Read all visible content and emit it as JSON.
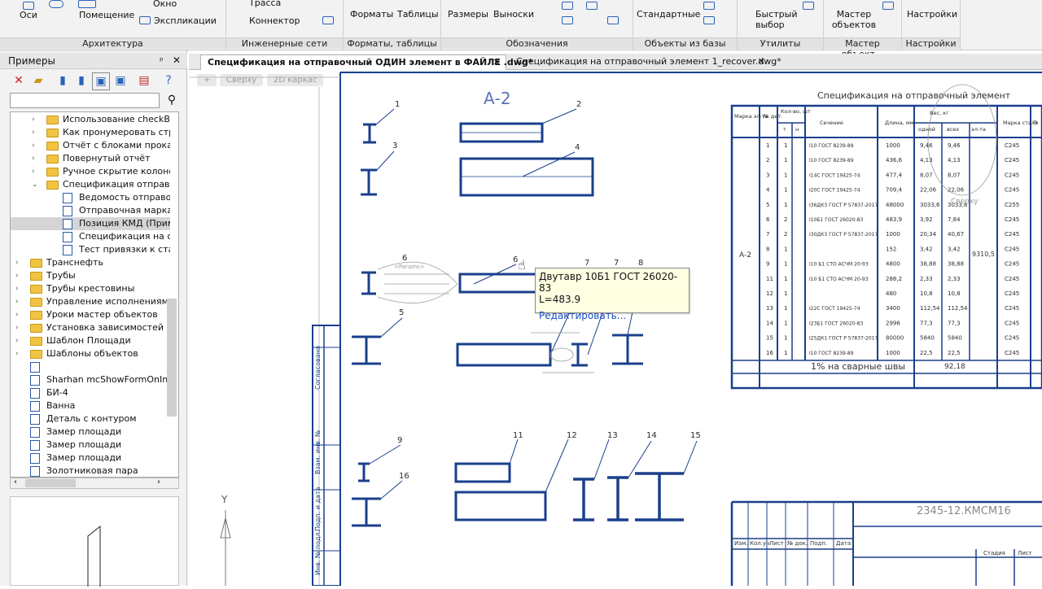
{
  "ribbon": {
    "groups": [
      {
        "label": "Архитектура",
        "items": [
          "Оси",
          "Помещение",
          "Окно",
          "Экспликации"
        ]
      },
      {
        "label": "Инженерные сети",
        "items": [
          "Трасса",
          "Коннектор"
        ]
      },
      {
        "label": "Форматы, таблицы",
        "items": [
          "Форматы",
          "Таблицы"
        ]
      },
      {
        "label": "Обозначения",
        "items": [
          "Размеры",
          "Выноски"
        ]
      },
      {
        "label": "Объекты из базы",
        "items": [
          "Стандартные"
        ]
      },
      {
        "label": "Утилиты",
        "items": [
          "Быстрый выбор"
        ]
      },
      {
        "label": "Мастер объект...",
        "items": [
          "Мастер объектов"
        ]
      },
      {
        "label": "Настройки",
        "items": [
          "Настройки"
        ]
      }
    ]
  },
  "panel": {
    "title": "Примеры",
    "pin": "ᵖ",
    "close": "✕",
    "search_placeholder": "",
    "tree": [
      {
        "label": "Использование checkBox",
        "type": "folder",
        "level": 1,
        "twist": "›"
      },
      {
        "label": "Как пронумеровать строки",
        "type": "folder",
        "level": 1,
        "twist": "›"
      },
      {
        "label": "Отчёт с блоками проката",
        "type": "folder",
        "level": 1,
        "twist": "›"
      },
      {
        "label": "Повернутый отчёт",
        "type": "folder",
        "level": 1,
        "twist": "›"
      },
      {
        "label": "Ручное скрытие колонок",
        "type": "folder",
        "level": 1,
        "twist": "›"
      },
      {
        "label": "Спецификация отправочн",
        "type": "folder",
        "level": 1,
        "twist": "⌄"
      },
      {
        "label": "Ведомость отправочн",
        "type": "doc",
        "level": 2,
        "twist": ""
      },
      {
        "label": "Отправочная марка",
        "type": "doc",
        "level": 2,
        "twist": ""
      },
      {
        "label": "Позиция КМД (Приме",
        "type": "doc",
        "level": 2,
        "twist": "",
        "selected": true
      },
      {
        "label": "Спецификация на отп",
        "type": "doc",
        "level": 2,
        "twist": ""
      },
      {
        "label": "Тест привязки к стан",
        "type": "doc",
        "level": 2,
        "twist": ""
      },
      {
        "label": "Транснефть",
        "type": "folder",
        "level": 0,
        "twist": "›"
      },
      {
        "label": "Трубы",
        "type": "folder",
        "level": 0,
        "twist": "›"
      },
      {
        "label": "Трубы крестовины",
        "type": "folder",
        "level": 0,
        "twist": "›"
      },
      {
        "label": "Управление исполнениями и",
        "type": "folder",
        "level": 0,
        "twist": "›"
      },
      {
        "label": "Уроки мастер объектов",
        "type": "folder",
        "level": 0,
        "twist": "›"
      },
      {
        "label": "Установка зависимостей чере",
        "type": "folder",
        "level": 0,
        "twist": "›"
      },
      {
        "label": "Шаблон Площади",
        "type": "folder",
        "level": 0,
        "twist": "›"
      },
      {
        "label": "Шаблоны объектов",
        "type": "folder",
        "level": 0,
        "twist": "›"
      },
      {
        "label": "",
        "type": "doc",
        "level": 0,
        "twist": ""
      },
      {
        "label": "Sharhan mcShowFormOnInsert",
        "type": "doc",
        "level": 0,
        "twist": ""
      },
      {
        "label": "БИ-4",
        "type": "doc",
        "level": 0,
        "twist": ""
      },
      {
        "label": "Ванна",
        "type": "doc",
        "level": 0,
        "twist": ""
      },
      {
        "label": "Деталь с контуром",
        "type": "doc",
        "level": 0,
        "twist": ""
      },
      {
        "label": "Замер площади",
        "type": "doc",
        "level": 0,
        "twist": ""
      },
      {
        "label": "Замер площади",
        "type": "doc",
        "level": 0,
        "twist": ""
      },
      {
        "label": "Замер площади",
        "type": "doc",
        "level": 0,
        "twist": ""
      },
      {
        "label": "Золотниковая пара",
        "type": "doc",
        "level": 0,
        "twist": ""
      }
    ]
  },
  "tabs": [
    {
      "label": "Спецификация на отправочный ОДИН элемент в ФАЙЛЕ .dwg*",
      "active": true
    },
    {
      "label": "Спецификация на отправочный элемент 1_recover.dwg*",
      "active": false
    }
  ],
  "viewport": {
    "plus": "+",
    "view": "Сверху",
    "style": "2D каркас"
  },
  "drawing": {
    "mark": "А-2",
    "table_title": "Спецификация на отправочный элемент",
    "headers": [
      "Марка эл-та",
      "№ дет.",
      "Кол-во, шт",
      "т",
      "н",
      "Сечение",
      "Длина, мм",
      "Вес, кг",
      "одной",
      "всех",
      "эл-та",
      "Марка стали",
      "П"
    ],
    "rows": [
      [
        "1",
        "1",
        "I10 ГОСТ 8239-89",
        "1000",
        "9,46",
        "9,46",
        "C245"
      ],
      [
        "2",
        "1",
        "I10 ГОСТ 8239-89",
        "436,6",
        "4,13",
        "4,13",
        "C245"
      ],
      [
        "3",
        "1",
        "I14С ГОСТ 19425-74",
        "477,4",
        "8,07",
        "8,07",
        "C245"
      ],
      [
        "4",
        "1",
        "I20С ГОСТ 19425-74",
        "709,4",
        "22,06",
        "22,06",
        "C245"
      ],
      [
        "5",
        "1",
        "I36ДК3 ГОСТ Р 57837-2017",
        "48000",
        "3033,6",
        "3033,6",
        "C255"
      ],
      [
        "6",
        "2",
        "I10Б1 ГОСТ 26020-83",
        "483,9",
        "3,92",
        "7,84",
        "C245"
      ],
      [
        "7",
        "2",
        "I30ДК3 ГОСТ Р 57837-2017",
        "1000",
        "20,34",
        "40,67",
        "C245"
      ],
      [
        "8",
        "1",
        "",
        "152",
        "3,42",
        "3,42",
        "C245"
      ],
      [
        "9",
        "1",
        "I10 Б1 СТО АСЧМ 20-93",
        "4800",
        "38,88",
        "38,88",
        "C245"
      ],
      [
        "11",
        "1",
        "I10 Б1 СТО АСЧМ 20-93",
        "288,2",
        "2,33",
        "2,33",
        "C245"
      ],
      [
        "12",
        "1",
        "",
        "480",
        "10,8",
        "10,8",
        "C245"
      ],
      [
        "13",
        "1",
        "I22С ГОСТ 19425-74",
        "3400",
        "112,54",
        "112,54",
        "C245"
      ],
      [
        "14",
        "1",
        "I23Б1 ГОСТ 26020-83",
        "2996",
        "77,3",
        "77,3",
        "C245"
      ],
      [
        "15",
        "1",
        "I25ДК1 ГОСТ Р 57837-2017",
        "80000",
        "5840",
        "5840",
        "C245"
      ],
      [
        "16",
        "1",
        "I10 ГОСТ 8239-89",
        "1000",
        "22,5",
        "22,5",
        "C245"
      ]
    ],
    "element_mark": "А-2",
    "element_weight": "9310,5",
    "footer_label": "1% на сварные швы",
    "footer_value": "92,18",
    "stamp_code": "2345-12.КМСМ16",
    "stamp_headers": [
      "Изм.",
      "Кол.уч",
      "Лист",
      "№ док.",
      "Подп.",
      "Дата"
    ],
    "stamp_sheet": [
      "Стадия",
      "Лист"
    ],
    "watermark_view": "Сверху",
    "frame_labels": [
      "Согласовано",
      "Взам. инв. №",
      "Подп. и дата",
      "Инв. № подл."
    ],
    "callouts": [
      "1",
      "2",
      "3",
      "4",
      "5",
      "6",
      "6",
      "7",
      "7",
      "8",
      "9",
      "11",
      "12",
      "13",
      "14",
      "15",
      "16"
    ],
    "axis_y": "Y",
    "params_label": "<Params>"
  },
  "tooltip": {
    "line1": "Двутавр 10Б1 ГОСТ 26020-83",
    "line2": "L=483.9",
    "action": "Редактировать..."
  },
  "colors": {
    "blueprint": "#1a3f8c",
    "accent": "#2a62b8",
    "tooltip_bg": "#ffffe2",
    "link": "#1a4fc4"
  }
}
